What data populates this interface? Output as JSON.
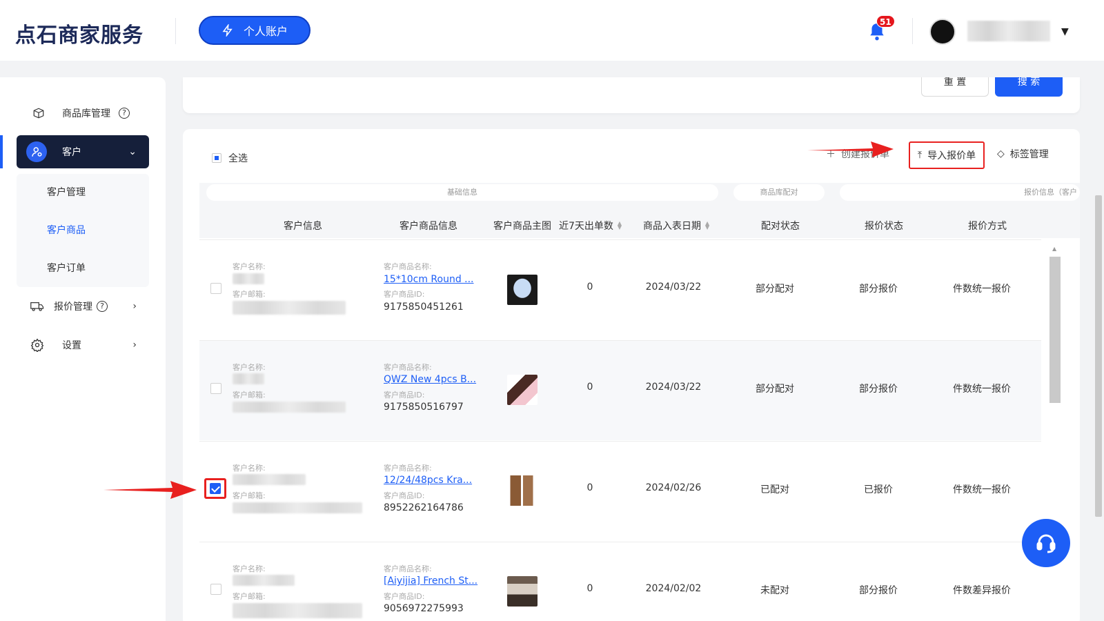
{
  "header": {
    "logo": "点石商家服务",
    "account_button": "个人账户",
    "notification_count": "51"
  },
  "sidebar": {
    "items": [
      {
        "label": "商品库管理",
        "icon": "box-icon"
      },
      {
        "label": "客户",
        "icon": "user-icon"
      },
      {
        "label": "报价管理",
        "icon": "truck-icon"
      },
      {
        "label": "设置",
        "icon": "gear-icon"
      }
    ],
    "submenu": [
      "客户管理",
      "客户商品",
      "客户订单"
    ]
  },
  "filter": {
    "reset": "重 置",
    "search": "搜 索"
  },
  "toolbar": {
    "select_all": "全选",
    "create": "创建报价单",
    "import": "导入报价单",
    "tags": "标签管理"
  },
  "table": {
    "groups": [
      "基础信息",
      "商品库配对",
      "报价信息（客户"
    ],
    "columns": [
      "客户信息",
      "客户商品信息",
      "客户商品主图",
      "近7天出单数",
      "商品入表日期",
      "配对状态",
      "报价状态",
      "报价方式"
    ],
    "labels": {
      "customer_name": "客户名称:",
      "customer_email": "客户邮箱:",
      "product_name": "客户商品名称:",
      "product_id": "客户商品ID:"
    },
    "rows": [
      {
        "product_name": "15*10cm Round ...",
        "product_id": "9175850451261",
        "orders": "0",
        "date": "2024/03/22",
        "match": "部分配对",
        "quote": "部分报价",
        "method": "件数统一报价",
        "checked": false
      },
      {
        "product_name": "QWZ New 4pcs B...",
        "product_id": "9175850516797",
        "orders": "0",
        "date": "2024/03/22",
        "match": "部分配对",
        "quote": "部分报价",
        "method": "件数统一报价",
        "checked": false
      },
      {
        "product_name": "12/24/48pcs Kra...",
        "product_id": "8952262164786",
        "orders": "0",
        "date": "2024/02/26",
        "match": "已配对",
        "quote": "已报价",
        "method": "件数统一报价",
        "checked": true
      },
      {
        "product_name": "[Aiyijia] French St...",
        "product_id": "9056972275993",
        "orders": "0",
        "date": "2024/02/02",
        "match": "未配对",
        "quote": "部分报价",
        "method": "件数差异报价",
        "checked": false
      }
    ]
  },
  "colors": {
    "primary": "#1d5ef6",
    "nav_dark": "#151f3a",
    "highlight_red": "#e8201f"
  }
}
